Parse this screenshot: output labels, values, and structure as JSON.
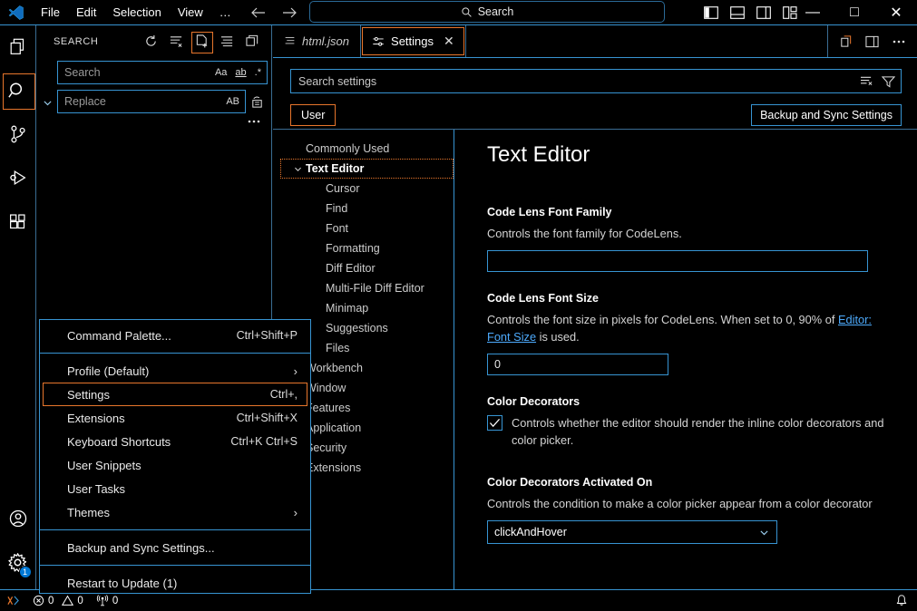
{
  "titlebar": {
    "logo_icon": "vscode-logo",
    "menus": [
      {
        "label": "File"
      },
      {
        "label": "Edit"
      },
      {
        "label": "Selection"
      },
      {
        "label": "View"
      },
      {
        "label": "…"
      }
    ],
    "nav": {
      "back_icon": "arrow-left-icon",
      "forward_icon": "arrow-right-icon"
    },
    "command_center": {
      "placeholder": "Search",
      "icon": "search-icon"
    },
    "layout_icons": [
      "toggle-primary-sidebar-icon",
      "toggle-panel-icon",
      "toggle-secondary-sidebar-icon",
      "customize-layout-icon"
    ],
    "window_controls": {
      "minimize": "—",
      "maximize": "□",
      "close": "✕"
    }
  },
  "activitybar": {
    "items": [
      {
        "name": "explorer",
        "icon": "files-icon",
        "active": false
      },
      {
        "name": "search",
        "icon": "search-icon",
        "active": true
      },
      {
        "name": "source-control",
        "icon": "source-control-icon",
        "active": false
      },
      {
        "name": "run-and-debug",
        "icon": "run-debug-icon",
        "active": false
      },
      {
        "name": "extensions",
        "icon": "extensions-icon",
        "active": false
      }
    ],
    "bottom": [
      {
        "name": "accounts",
        "icon": "account-icon",
        "badge": ""
      },
      {
        "name": "manage",
        "icon": "gear-icon",
        "badge": "1"
      }
    ]
  },
  "sidebar": {
    "title": "SEARCH",
    "actions": [
      {
        "name": "refresh",
        "icon": "refresh-icon",
        "boxed": false
      },
      {
        "name": "clear-search-results",
        "icon": "clear-all-icon",
        "boxed": false
      },
      {
        "name": "open-new-search-editor",
        "icon": "new-search-editor-icon",
        "boxed": true
      },
      {
        "name": "view-as-tree",
        "icon": "list-flat-icon",
        "boxed": false
      },
      {
        "name": "collapse-all",
        "icon": "collapse-all-icon",
        "boxed": false
      }
    ],
    "toggle_replace_icon": "chevron-down-icon",
    "search_input": {
      "placeholder": "Search",
      "value": "",
      "options": [
        {
          "name": "match-case",
          "label": "Aa"
        },
        {
          "name": "match-whole-word",
          "label": "ab"
        },
        {
          "name": "use-regex",
          "label": ".*"
        }
      ]
    },
    "replace_input": {
      "placeholder": "Replace",
      "value": "",
      "options": [
        {
          "name": "preserve-case",
          "label": "AB"
        }
      ],
      "replace_all_icon": "replace-all-icon"
    },
    "more_actions_icon": "ellipsis-icon"
  },
  "context_menu": {
    "items": [
      {
        "type": "item",
        "label": "Command Palette...",
        "keybinding": "Ctrl+Shift+P",
        "selected": false,
        "submenu": false
      },
      {
        "type": "separator"
      },
      {
        "type": "item",
        "label": "Profile (Default)",
        "keybinding": "",
        "selected": false,
        "submenu": true
      },
      {
        "type": "item",
        "label": "Settings",
        "keybinding": "Ctrl+,",
        "selected": true,
        "submenu": false
      },
      {
        "type": "item",
        "label": "Extensions",
        "keybinding": "Ctrl+Shift+X",
        "selected": false,
        "submenu": false
      },
      {
        "type": "item",
        "label": "Keyboard Shortcuts",
        "keybinding": "Ctrl+K Ctrl+S",
        "selected": false,
        "submenu": false
      },
      {
        "type": "item",
        "label": "User Snippets",
        "keybinding": "",
        "selected": false,
        "submenu": false
      },
      {
        "type": "item",
        "label": "User Tasks",
        "keybinding": "",
        "selected": false,
        "submenu": false
      },
      {
        "type": "item",
        "label": "Themes",
        "keybinding": "",
        "selected": false,
        "submenu": true
      },
      {
        "type": "separator"
      },
      {
        "type": "item",
        "label": "Backup and Sync Settings...",
        "keybinding": "",
        "selected": false,
        "submenu": false
      },
      {
        "type": "separator"
      },
      {
        "type": "item",
        "label": "Restart to Update (1)",
        "keybinding": "",
        "selected": false,
        "submenu": false
      }
    ]
  },
  "editor": {
    "tabs": [
      {
        "label": "html.json",
        "icon": "json-file-icon",
        "active": false,
        "italic": true,
        "closable": false
      },
      {
        "label": "Settings",
        "icon": "settings-gear-icon",
        "active": true,
        "italic": false,
        "closable": true,
        "close_glyph": "✕"
      }
    ],
    "tab_actions": [
      {
        "name": "split-editor-right",
        "icon": "split-editor-icon"
      },
      {
        "name": "toggle-secondary-sidebar",
        "icon": "secondary-sidebar-icon"
      },
      {
        "name": "more-actions",
        "icon": "ellipsis-icon"
      }
    ]
  },
  "settings_editor": {
    "search": {
      "placeholder": "Search settings",
      "value": "",
      "clear_icon": "clear-filter-icon",
      "filter_icon": "filter-icon"
    },
    "scope_tab": "User",
    "sync_button": "Backup and Sync Settings",
    "toc": [
      {
        "label": "Commonly Used",
        "level": 1,
        "group": false,
        "chevron": "",
        "focused": false,
        "bullet": false
      },
      {
        "label": "Text Editor",
        "level": 1,
        "group": true,
        "chevron": "⌄",
        "focused": true,
        "bullet": false
      },
      {
        "label": "Cursor",
        "level": 2,
        "group": false,
        "chevron": "",
        "focused": false,
        "bullet": false
      },
      {
        "label": "Find",
        "level": 2,
        "group": false,
        "chevron": "",
        "focused": false,
        "bullet": false
      },
      {
        "label": "Font",
        "level": 2,
        "group": false,
        "chevron": "",
        "focused": false,
        "bullet": false
      },
      {
        "label": "Formatting",
        "level": 2,
        "group": false,
        "chevron": "",
        "focused": false,
        "bullet": false
      },
      {
        "label": "Diff Editor",
        "level": 2,
        "group": false,
        "chevron": "",
        "focused": false,
        "bullet": false
      },
      {
        "label": "Multi-File Diff Editor",
        "level": 2,
        "group": false,
        "chevron": "",
        "focused": false,
        "bullet": false
      },
      {
        "label": "Minimap",
        "level": 2,
        "group": false,
        "chevron": "",
        "focused": false,
        "bullet": false
      },
      {
        "label": "Suggestions",
        "level": 2,
        "group": false,
        "chevron": "",
        "focused": false,
        "bullet": false
      },
      {
        "label": "Files",
        "level": 2,
        "group": false,
        "chevron": "",
        "focused": false,
        "bullet": false
      },
      {
        "label": "Workbench",
        "level": 1,
        "group": false,
        "chevron": "",
        "focused": false,
        "bullet": true
      },
      {
        "label": "Window",
        "level": 1,
        "group": false,
        "chevron": "",
        "focused": false,
        "bullet": true
      },
      {
        "label": "Features",
        "level": 1,
        "group": false,
        "chevron": "",
        "focused": false,
        "bullet": true
      },
      {
        "label": "Application",
        "level": 1,
        "group": false,
        "chevron": "",
        "focused": false,
        "bullet": true
      },
      {
        "label": "Security",
        "level": 1,
        "group": false,
        "chevron": "",
        "focused": false,
        "bullet": true
      },
      {
        "label": "Extensions",
        "level": 1,
        "group": false,
        "chevron": "",
        "focused": false,
        "bullet": true
      }
    ],
    "content_title": "Text Editor",
    "settings": [
      {
        "kind": "text",
        "name": "Code Lens Font Family",
        "description": "Controls the font family for CodeLens.",
        "value": ""
      },
      {
        "kind": "number",
        "name": "Code Lens Font Size",
        "description_pre": "Controls the font size in pixels for CodeLens. When set to 0, 90% of ",
        "description_link": "Editor: Font Size",
        "description_post": " is used.",
        "value": "0"
      },
      {
        "kind": "checkbox",
        "name": "Color Decorators",
        "description": "Controls whether the editor should render the inline color decorators and color picker.",
        "checked": true
      },
      {
        "kind": "select",
        "name": "Color Decorators Activated On",
        "description": "Controls the condition to make a color picker appear from a color decorator",
        "value": "clickAndHover",
        "chevron": "⌄"
      }
    ]
  },
  "statusbar": {
    "remote_icon": "remote-window-icon",
    "problems": {
      "errors_icon": "error-icon",
      "errors": "0",
      "warnings_icon": "warning-icon",
      "warnings": "0"
    },
    "ports": {
      "icon": "radio-tower-icon",
      "count": "0"
    },
    "notifications_icon": "bell-icon"
  },
  "colors": {
    "accent_blue": "#3794d2",
    "focus_orange": "#e8762c",
    "link_blue": "#4daafc",
    "background": "#000000",
    "text": "#ffffff"
  }
}
